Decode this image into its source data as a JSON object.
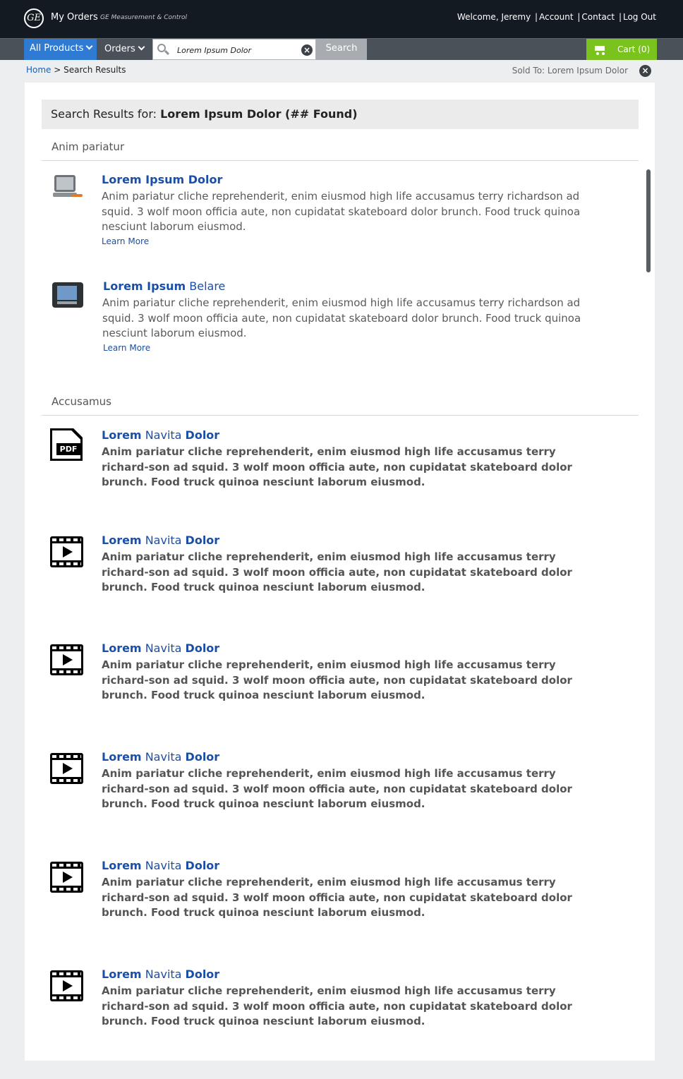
{
  "header": {
    "logo_text": "GE",
    "app_title": "My Orders",
    "app_subtitle": "GE Measurement & Control",
    "welcome": "Welcome, Jeremy",
    "account": "Account",
    "contact": "Contact",
    "logout": "Log Out",
    "separator": "|"
  },
  "nav": {
    "all_products": "All Products",
    "orders": "Orders",
    "search_value": "Lorem Ipsum Dolor",
    "search_button": "Search",
    "cart": "Cart (0)",
    "clear_glyph": "×"
  },
  "breadcrumb": {
    "home": "Home",
    "separator": " > ",
    "current": "Search Results",
    "sold_to": "Sold To: Lorem Ipsum Dolor"
  },
  "results": {
    "prefix": "Search Results for: ",
    "query": "Lorem Ipsum Dolor (## Found)"
  },
  "sections": [
    {
      "title": "Anim pariatur",
      "items": [
        {
          "title_bold": "Lorem Ipsum Dolor",
          "title_rest": "",
          "description": "Anim pariatur cliche reprehenderit, enim eiusmod high life accusamus terry richardson ad squid. 3 wolf moon officia aute, non cupidatat skateboard dolor brunch. Food truck quinoa nesciunt laborum eiusmod.",
          "link": "Learn More",
          "icon": "product-image-icon"
        },
        {
          "title_bold": "Lorem Ipsum",
          "title_rest": " Belare",
          "description": "Anim pariatur cliche reprehenderit, enim eiusmod high life accusamus terry richardson ad squid. 3 wolf moon officia aute, non cupidatat skateboard dolor brunch. Food truck quinoa nesciunt laborum eiusmod.",
          "link": "Learn More",
          "icon": "product-image-icon"
        }
      ]
    },
    {
      "title": "Accusamus",
      "items": [
        {
          "title_a": "Lorem",
          "title_b": " Navita ",
          "title_c": "Dolor",
          "description": "Anim pariatur cliche reprehenderit, enim eiusmod high life accusamus terry richard-son ad squid. 3 wolf moon officia aute, non cupidatat skateboard dolor brunch. Food truck quinoa nesciunt laborum eiusmod.",
          "icon": "pdf-icon",
          "icon_label": "PDF"
        },
        {
          "title_a": "Lorem",
          "title_b": " Navita ",
          "title_c": "Dolor",
          "description": "Anim pariatur cliche reprehenderit, enim eiusmod high life accusamus terry richard-son ad squid. 3 wolf moon officia aute, non cupidatat skateboard dolor brunch. Food truck quinoa nesciunt laborum eiusmod.",
          "icon": "video-icon"
        },
        {
          "title_a": "Lorem",
          "title_b": " Navita ",
          "title_c": "Dolor",
          "description": "Anim pariatur cliche reprehenderit, enim eiusmod high life accusamus terry richard-son ad squid. 3 wolf moon officia aute, non cupidatat skateboard dolor brunch. Food truck quinoa nesciunt laborum eiusmod.",
          "icon": "video-icon"
        },
        {
          "title_a": "Lorem",
          "title_b": " Navita ",
          "title_c": "Dolor",
          "description": "Anim pariatur cliche reprehenderit, enim eiusmod high life accusamus terry richard-son ad squid. 3 wolf moon officia aute, non cupidatat skateboard dolor brunch. Food truck quinoa nesciunt laborum eiusmod.",
          "icon": "video-icon"
        },
        {
          "title_a": "Lorem",
          "title_b": " Navita ",
          "title_c": "Dolor",
          "description": "Anim pariatur cliche reprehenderit, enim eiusmod high life accusamus terry richard-son ad squid. 3 wolf moon officia aute, non cupidatat skateboard dolor brunch. Food truck quinoa nesciunt laborum eiusmod.",
          "icon": "video-icon"
        },
        {
          "title_a": "Lorem",
          "title_b": " Navita ",
          "title_c": "Dolor",
          "description": "Anim pariatur cliche reprehenderit, enim eiusmod high life accusamus terry richard-son ad squid. 3 wolf moon officia aute, non cupidatat skateboard dolor brunch. Food truck quinoa nesciunt laborum eiusmod.",
          "icon": "video-icon"
        }
      ]
    }
  ],
  "colors": {
    "header_bg": "#141a22",
    "nav_bg": "#4b5159",
    "accent_blue": "#2f7bd4",
    "cart_green": "#7ac21e",
    "link_blue": "#1a4fa8"
  }
}
